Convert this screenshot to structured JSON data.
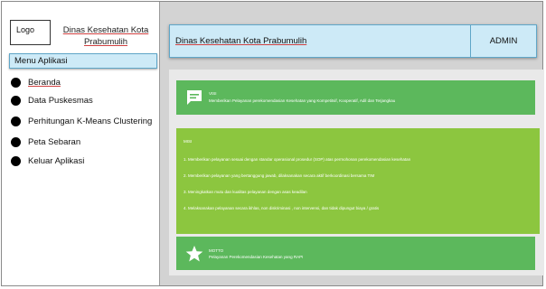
{
  "sidebar": {
    "logo": "Logo",
    "app_name": "Dinas Kesehatan Kota Prabumulih",
    "menu_header": "Menu Aplikasi",
    "items": [
      {
        "label": "Beranda",
        "underline": true
      },
      {
        "label": "Data Puskesmas",
        "underline": false
      },
      {
        "label": "Perhitungan K-Means Clustering",
        "underline": false
      },
      {
        "label": "Peta Sebaran",
        "underline": false
      },
      {
        "label": "Keluar Aplikasi",
        "underline": false
      }
    ]
  },
  "header": {
    "title": "Dinas Kesehatan Kota Prabumulih",
    "user": "ADMIN"
  },
  "visi": {
    "heading": "VISI",
    "text": "Memberikan Pelayanan perekomendasian Kesehatan yang Kompetitsif, Kooperatif, Adil dan Terjangkau",
    "icon": "chat-bubble-icon"
  },
  "misi": {
    "heading": "MISI",
    "items": [
      "1. Memberikan pelayanan sesuai dengan standar operasional prosedur (SOP) atas permohonan perekomendasian kesehatan",
      "2. Memberikan pelayanan yang bertanggung jawab, dilaksanakan secara aktif berkoordinasi bersama TIM",
      "3. Meningkatkan mutu dan kualitas pelayanan dengan asas keadilan",
      "4. Melaksanakan pelayanan secara ikhlas, non diskriminasi , non intervensi, dan tidak dipungut biaya / gratis"
    ]
  },
  "motto": {
    "heading": "MOTTO",
    "text": "Pelayanan Perekomendasian Kesehatan yang RAPI",
    "icon": "star-icon"
  },
  "colors": {
    "menu_bg": "#cdeaf7",
    "card_green": "#5cb85c",
    "misi_green": "#8cc63f",
    "main_bg": "#d3d3d3"
  }
}
